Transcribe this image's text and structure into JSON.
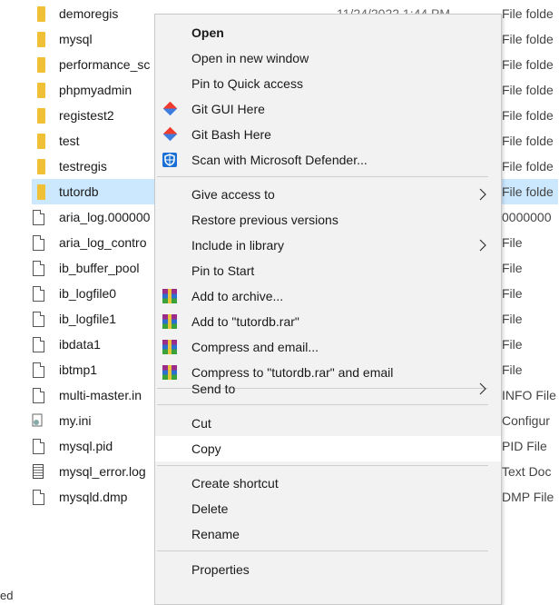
{
  "files": [
    {
      "name": "demoregis",
      "type": "File folde",
      "date": "11/24/2022 1:44 PM",
      "icon": "folder-icon"
    },
    {
      "name": "mysql",
      "type": "File folde",
      "icon": "folder-icon"
    },
    {
      "name": "performance_sc",
      "type": "File folde",
      "icon": "folder-icon"
    },
    {
      "name": "phpmyadmin",
      "type": "File folde",
      "icon": "folder-icon"
    },
    {
      "name": "registest2",
      "type": "File folde",
      "icon": "folder-icon"
    },
    {
      "name": "test",
      "type": "File folde",
      "icon": "folder-icon"
    },
    {
      "name": "testregis",
      "type": "File folde",
      "icon": "folder-icon"
    },
    {
      "name": "tutordb",
      "type": "File folde",
      "icon": "folder-icon",
      "selected": true
    },
    {
      "name": "aria_log.000000",
      "type": "0000000",
      "icon": "file-icon"
    },
    {
      "name": "aria_log_contro",
      "type": "File",
      "icon": "file-icon"
    },
    {
      "name": "ib_buffer_pool",
      "type": "File",
      "icon": "file-icon"
    },
    {
      "name": "ib_logfile0",
      "type": "File",
      "icon": "file-icon"
    },
    {
      "name": "ib_logfile1",
      "type": "File",
      "icon": "file-icon"
    },
    {
      "name": "ibdata1",
      "type": "File",
      "icon": "file-icon"
    },
    {
      "name": "ibtmp1",
      "type": "File",
      "icon": "file-icon"
    },
    {
      "name": "multi-master.in",
      "type": "INFO File",
      "icon": "file-icon"
    },
    {
      "name": "my.ini",
      "type": "Configur",
      "icon": "ini-icon"
    },
    {
      "name": "mysql.pid",
      "type": "PID File",
      "icon": "file-icon"
    },
    {
      "name": "mysql_error.log",
      "type": "Text Doc",
      "icon": "text-file-icon"
    },
    {
      "name": "mysqld.dmp",
      "type": "DMP File",
      "icon": "file-icon"
    }
  ],
  "status_text": "ed",
  "context_menu": {
    "items": [
      {
        "label": "Open",
        "bold": true
      },
      {
        "label": "Open in new window"
      },
      {
        "label": "Pin to Quick access"
      },
      {
        "label": "Git GUI Here",
        "icon": "git-icon"
      },
      {
        "label": "Git Bash Here",
        "icon": "git-icon"
      },
      {
        "label": "Scan with Microsoft Defender...",
        "icon": "defender-icon"
      },
      {
        "label": "Give access to",
        "submenu": true
      },
      {
        "label": "Restore previous versions"
      },
      {
        "label": "Include in library",
        "submenu": true
      },
      {
        "label": "Pin to Start"
      },
      {
        "label": "Add to archive...",
        "icon": "winrar-icon"
      },
      {
        "label": "Add to \"tutordb.rar\"",
        "icon": "winrar-icon"
      },
      {
        "label": "Compress and email...",
        "icon": "winrar-icon"
      },
      {
        "label": "Compress to \"tutordb.rar\" and email",
        "icon": "winrar-icon"
      },
      {
        "label": "Send to",
        "submenu": true
      },
      {
        "label": "Cut"
      },
      {
        "label": "Copy",
        "highlighted": true
      },
      {
        "label": "Create shortcut"
      },
      {
        "label": "Delete"
      },
      {
        "label": "Rename"
      },
      {
        "label": "Properties"
      }
    ]
  },
  "colors": {
    "selection": "#cce8ff",
    "menu_bg": "#f2f2f2",
    "menu_highlight": "#ffffff",
    "folder": "#f0c036"
  }
}
